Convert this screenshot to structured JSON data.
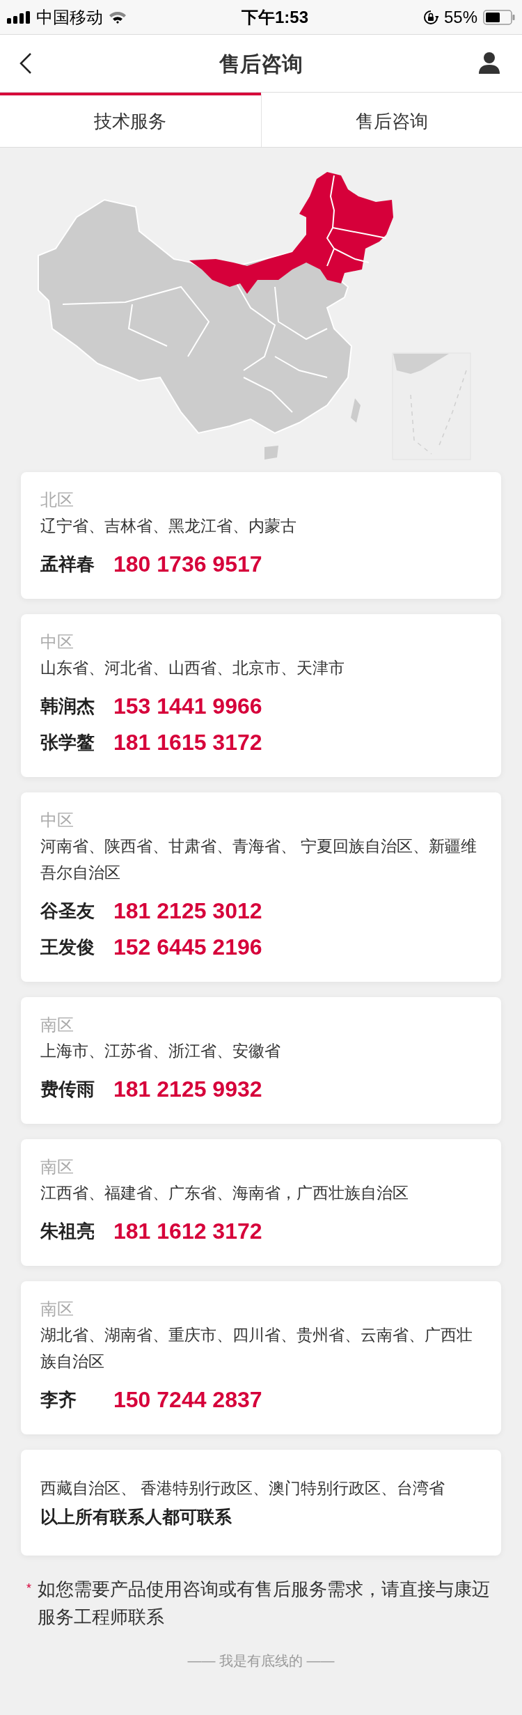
{
  "status_bar": {
    "carrier": "中国移动",
    "time": "下午1:53",
    "battery": "55%"
  },
  "header": {
    "title": "售后咨询"
  },
  "tabs": [
    {
      "label": "技术服务",
      "selected": true
    },
    {
      "label": "售后咨询",
      "selected": false
    }
  ],
  "cards": [
    {
      "region": "北区",
      "areas": "辽宁省、吉林省、黑龙江省、内蒙古",
      "contacts": [
        {
          "name": "孟祥春",
          "phone": "180 1736 9517"
        }
      ]
    },
    {
      "region": "中区",
      "areas": "山东省、河北省、山西省、北京市、天津市",
      "contacts": [
        {
          "name": "韩润杰",
          "phone": "153 1441 9966"
        },
        {
          "name": "张学鳌",
          "phone": "181 1615 3172"
        }
      ]
    },
    {
      "region": "中区",
      "areas": "河南省、陕西省、甘肃省、青海省、 宁夏回族自治区、新疆维吾尔自治区",
      "contacts": [
        {
          "name": "谷圣友",
          "phone": "181 2125 3012"
        },
        {
          "name": "王发俊",
          "phone": "152 6445 2196"
        }
      ]
    },
    {
      "region": "南区",
      "areas": "上海市、江苏省、浙江省、安徽省",
      "contacts": [
        {
          "name": "费传雨",
          "phone": "181 2125 9932"
        }
      ]
    },
    {
      "region": "南区",
      "areas": "江西省、福建省、广东省、海南省，广西壮族自治区",
      "contacts": [
        {
          "name": "朱祖亮",
          "phone": "181 1612 3172"
        }
      ]
    },
    {
      "region": "南区",
      "areas": "湖北省、湖南省、重庆市、四川省、贵州省、云南省、广西壮族自治区",
      "contacts": [
        {
          "name": "李齐",
          "phone": "150 7244 2837"
        }
      ]
    },
    {
      "areas": "西藏自治区、 香港特别行政区、澳门特别行政区、台湾省",
      "note": "以上所有联系人都可联系"
    }
  ],
  "notice": {
    "mark": "*",
    "text": "如您需要产品使用咨询或有售后服务需求，请直接与康迈服务工程师联系"
  },
  "footer": "—— 我是有底线的 ——"
}
